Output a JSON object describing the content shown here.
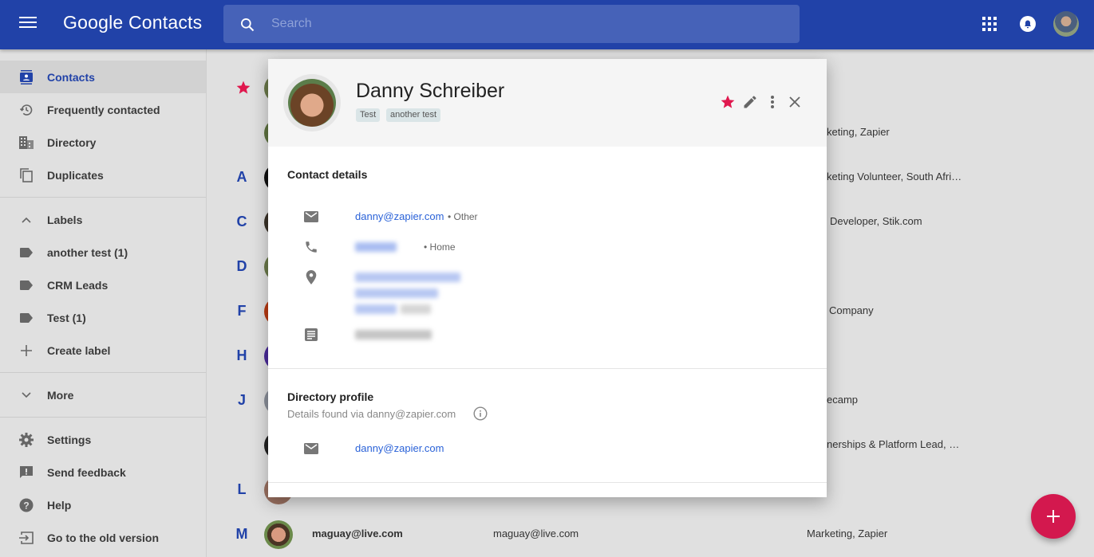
{
  "app": {
    "logo_google": "Google",
    "logo_product": "Contacts"
  },
  "search": {
    "placeholder": "Search",
    "value": ""
  },
  "sidebar": {
    "items": [
      {
        "label": "Contacts",
        "icon": "contacts-icon",
        "active": true
      },
      {
        "label": "Frequently contacted",
        "icon": "history-icon"
      },
      {
        "label": "Directory",
        "icon": "building-icon"
      },
      {
        "label": "Duplicates",
        "icon": "copy-icon"
      }
    ],
    "labels_header": "Labels",
    "labels": [
      {
        "label": "another test (1)"
      },
      {
        "label": "CRM Leads"
      },
      {
        "label": "Test (1)"
      }
    ],
    "create_label": "Create label",
    "more": "More",
    "footer": [
      {
        "label": "Settings",
        "icon": "gear-icon"
      },
      {
        "label": "Send feedback",
        "icon": "feedback-icon"
      },
      {
        "label": "Help",
        "icon": "help-icon"
      },
      {
        "label": "Go to the old version",
        "icon": "exit-icon"
      }
    ]
  },
  "list": {
    "rows": [
      {
        "letter": "★",
        "job": ""
      },
      {
        "letter": "",
        "job": "keting, Zapier"
      },
      {
        "letter": "A",
        "job": "keting Volunteer, South Afri…"
      },
      {
        "letter": "C",
        "job": "Developer, Stik.com"
      },
      {
        "letter": "D",
        "job": ""
      },
      {
        "letter": "F",
        "job": "Company"
      },
      {
        "letter": "H",
        "job": ""
      },
      {
        "letter": "J",
        "job": "ecamp"
      },
      {
        "letter": "",
        "job": "nerships & Platform Lead, …"
      },
      {
        "letter": "L",
        "job": ""
      },
      {
        "letter": "M",
        "name": "maguay@live.com",
        "email": "maguay@live.com",
        "job": "Marketing, Zapier"
      }
    ]
  },
  "dialog": {
    "name": "Danny Schreiber",
    "labels": [
      "Test",
      "another test"
    ],
    "starred": true,
    "contact_details_title": "Contact details",
    "email": "danny@zapier.com",
    "email_type": "• Other",
    "phone_type": "• Home",
    "directory_title": "Directory profile",
    "directory_subtitle": "Details found via danny@zapier.com",
    "directory_email": "danny@zapier.com"
  },
  "colors": {
    "brand": "#2142a8",
    "accent": "#d3184e",
    "link": "#2a62d8"
  }
}
